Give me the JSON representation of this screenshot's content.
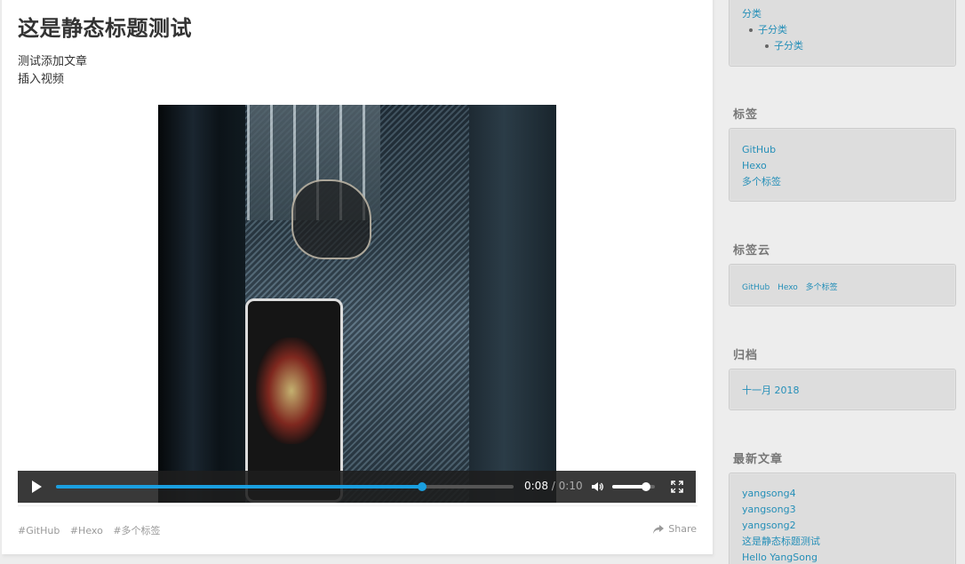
{
  "article": {
    "title": "这是静态标题测试",
    "body_lines": [
      "测试添加文章",
      "插入视频"
    ],
    "tags": [
      "#GitHub",
      "#Hexo",
      "#多个标签"
    ],
    "share_label": "Share"
  },
  "video": {
    "current_time": "0:08",
    "separator": "/",
    "duration": "0:10",
    "progress_fraction": 0.8,
    "volume_fraction": 0.8,
    "accent_color": "#1a9fe0"
  },
  "sidebar": {
    "categories": {
      "items": [
        "分类",
        "子分类",
        "子分类"
      ]
    },
    "tags": {
      "title": "标签",
      "items": [
        "GitHub",
        "Hexo",
        "多个标签"
      ]
    },
    "tagcloud": {
      "title": "标签云",
      "items": [
        "GitHub",
        "Hexo",
        "多个标签"
      ]
    },
    "archive": {
      "title": "归档",
      "items": [
        "十一月 2018"
      ]
    },
    "recent": {
      "title": "最新文章",
      "items": [
        "yangsong4",
        "yangsong3",
        "yangsong2",
        "这是静态标题测试",
        "Hello YangSong"
      ]
    }
  },
  "colors": {
    "link": "#258fb8",
    "background": "#ededed"
  }
}
